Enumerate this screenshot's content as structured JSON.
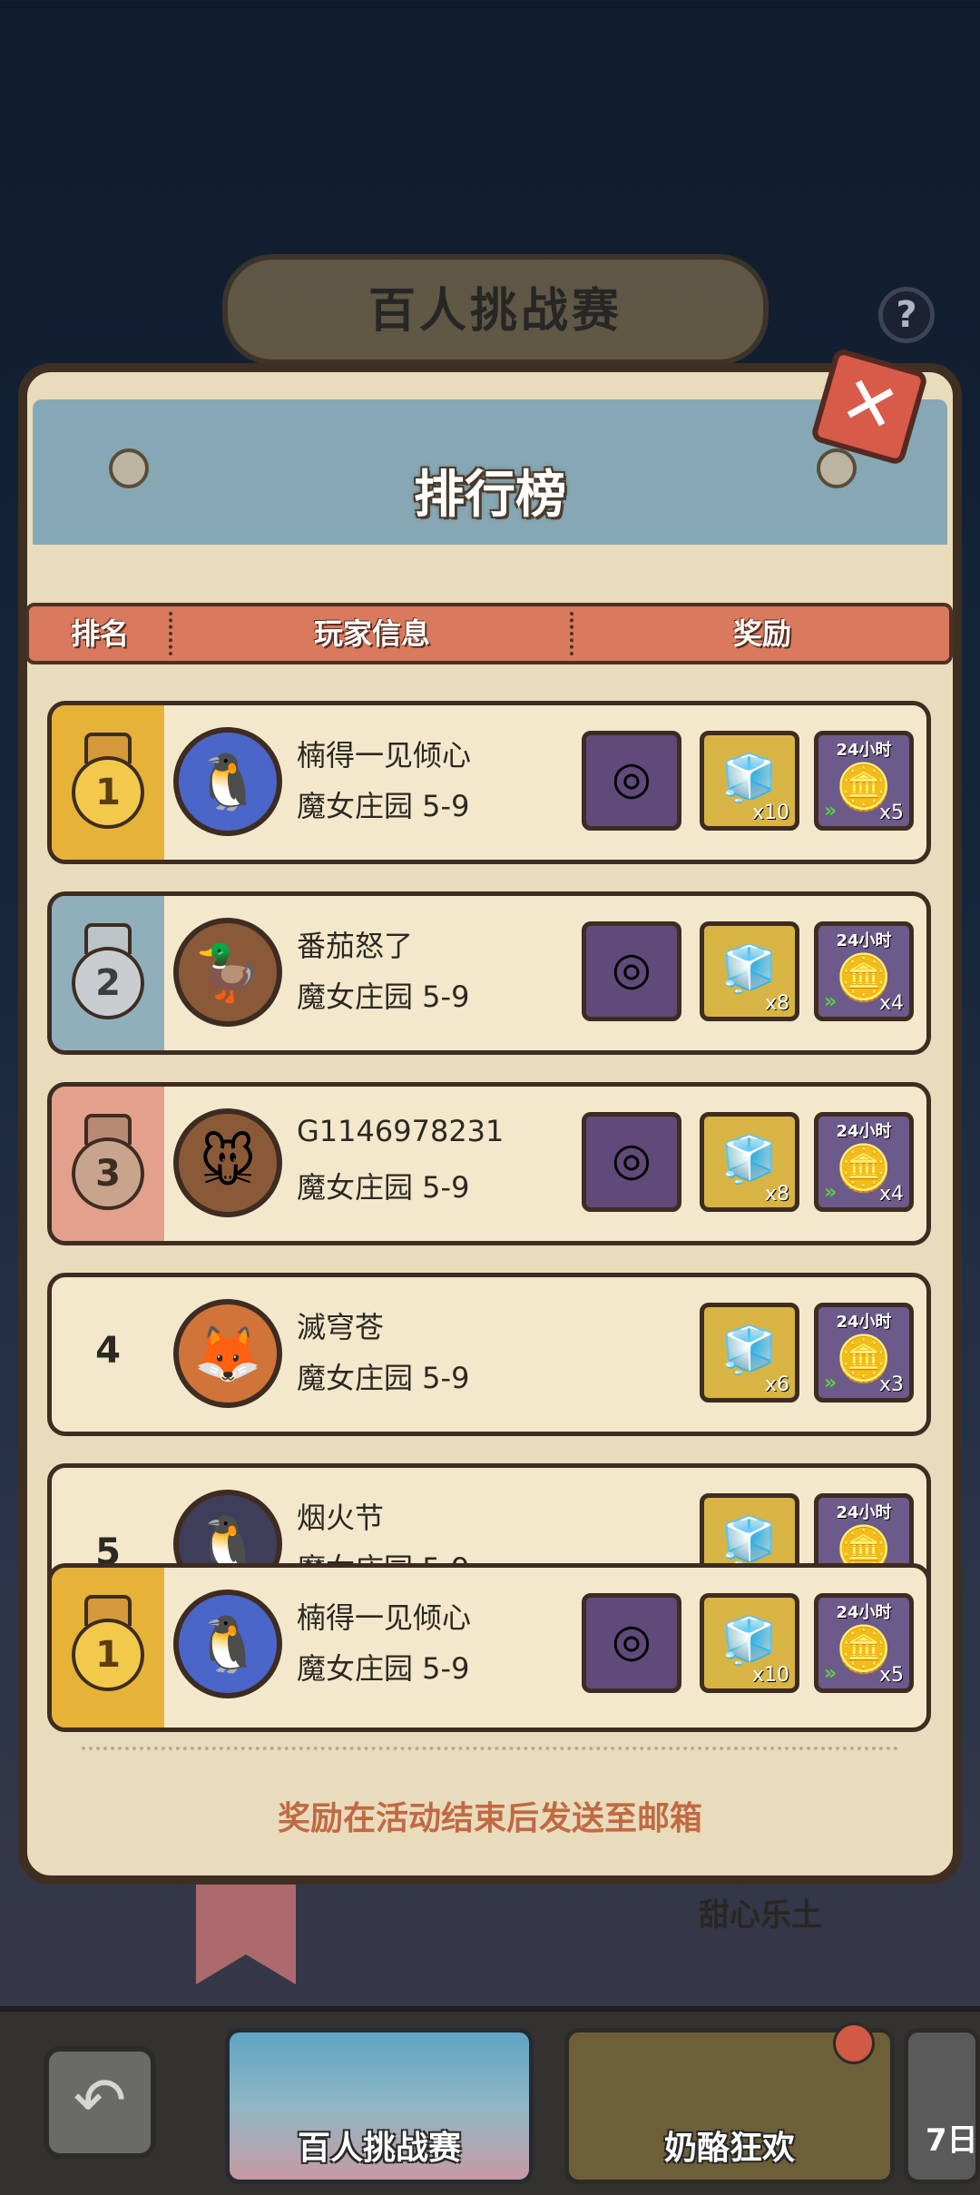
{
  "background": {
    "event_banner_title": "百人挑战赛",
    "behind_text": "甜心乐土"
  },
  "board": {
    "title": "排行榜",
    "close_glyph": "✕",
    "help_glyph": "?"
  },
  "table_headers": {
    "rank": "排名",
    "player_info": "玩家信息",
    "reward": "奖励"
  },
  "rows": [
    {
      "rank": "1",
      "name": "楠得一见倾心",
      "level": "魔女庄园 5-9",
      "rewards": {
        "frame": true,
        "cube_qty": "x10",
        "coin_tag": "24小时",
        "coin_qty": "x5"
      }
    },
    {
      "rank": "2",
      "name": "番茄怒了",
      "level": "魔女庄园 5-9",
      "rewards": {
        "frame": true,
        "cube_qty": "x8",
        "coin_tag": "24小时",
        "coin_qty": "x4"
      }
    },
    {
      "rank": "3",
      "name": "G1146978231",
      "level": "魔女庄园 5-9",
      "rewards": {
        "frame": true,
        "cube_qty": "x8",
        "coin_tag": "24小时",
        "coin_qty": "x4"
      }
    },
    {
      "rank": "4",
      "name": "滅穹苍",
      "level": "魔女庄园 5-9",
      "rewards": {
        "cube_qty": "x6",
        "coin_tag": "24小时",
        "coin_qty": "x3"
      }
    },
    {
      "rank": "5",
      "name": "烟火节",
      "level": "魔女庄园 5-9",
      "rewards": {
        "coin_tag": "24小时"
      }
    }
  ],
  "my_row": {
    "rank": "1",
    "name": "楠得一见倾心",
    "level": "魔女庄园 5-9",
    "rewards": {
      "cube_qty": "x10",
      "coin_tag": "24小时",
      "coin_qty": "x5"
    }
  },
  "footnote": "奖励在活动结束后发送至邮箱",
  "bottom_tabs": [
    {
      "label": "百人挑战赛"
    },
    {
      "label": "奶酪狂欢"
    },
    {
      "label": "7日"
    }
  ],
  "colors": {
    "gold": "#e6b238",
    "silver": "#9aa4a8",
    "bronze": "#c48a70",
    "accent": "#d9795d"
  }
}
